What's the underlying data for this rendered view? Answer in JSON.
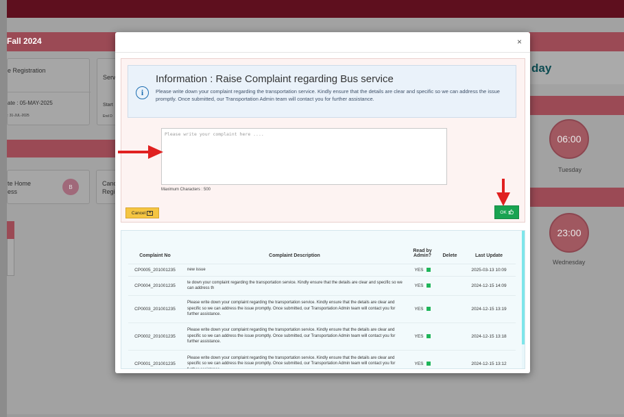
{
  "background": {
    "term_title": "Fall 2024",
    "card1_title": "e Registration",
    "card1_date": "ate : 05-MAY-2025",
    "card1_end": ": 31-JUL-2025",
    "card2_title": "Serv",
    "card2_start": "Start",
    "card2_end": "End D",
    "card3_title_line1": "te Home",
    "card3_title_line2": "ess",
    "card3_icon": "B",
    "card4_title_line1": "Canc",
    "card4_title_line2": "Regi",
    "day_title": "day",
    "time1": "06:00",
    "day1": "Tuesday",
    "time2": "23:00",
    "day2": "Wednesday"
  },
  "modal": {
    "close_label": "×",
    "info_title": "Information : Raise Complaint regarding Bus service",
    "info_description": "Please write down your complaint regarding the transportation service. Kindly ensure that the details are clear and specific so we can address the issue promptly. Once submitted, our Transportation Admin team will contact you for further assistance.",
    "info_icon": "i",
    "textarea_placeholder": "Please write your complaint here ....",
    "textarea_value": "",
    "max_characters_label": "Maximum Characters : 500",
    "cancel_label": "Cancel",
    "cancel_icon": "✕",
    "ok_label": "OK",
    "ok_icon": "thumbs-up-icon",
    "table": {
      "headers": {
        "complaint_no": "Complaint No",
        "description": "Complaint Description",
        "read_by_admin_line1": "Read by",
        "read_by_admin_line2": "Admin?",
        "delete": "Delete",
        "last_update": "Last Update"
      },
      "rows": [
        {
          "no": "CP0005_201001235",
          "desc": "new issue",
          "read": "YES",
          "update": "2025-03-13 10:09"
        },
        {
          "no": "CP0004_201001235",
          "desc": "te down your complaint regarding the transportation service. Kindly ensure that the details are clear and specific so we can address th",
          "read": "YES",
          "update": "2024-12-15 14:09"
        },
        {
          "no": "CP0003_201001235",
          "desc": "Please write down your complaint regarding the transportation service. Kindly ensure that the details are clear and specific so we can address the issue promptly. Once submitted, our Transportation Admin team will contact you for further assistance.",
          "read": "YES",
          "update": "2024-12-15 13:19"
        },
        {
          "no": "CP0002_201001235",
          "desc": "Please write down your complaint regarding the transportation service. Kindly ensure that the details are clear and specific so we can address the issue promptly. Once submitted, our Transportation Admin team will contact you for further assistance.",
          "read": "YES",
          "update": "2024-12-15 13:18"
        },
        {
          "no": "CP0001_201001235",
          "desc": "Please write down your complaint regarding the transportation service. Kindly ensure that the details are clear and specific so we can address the issue promptly. Once submitted, our Transportation Admin team will contact you for further assistance.",
          "read": "YES",
          "update": "2024-12-15 13:12"
        }
      ]
    }
  },
  "colors": {
    "ok_green": "#19a351",
    "cancel_yellow": "#f5c542",
    "arrow_red": "#e02020",
    "read_indicator_green": "#1fb55a"
  }
}
